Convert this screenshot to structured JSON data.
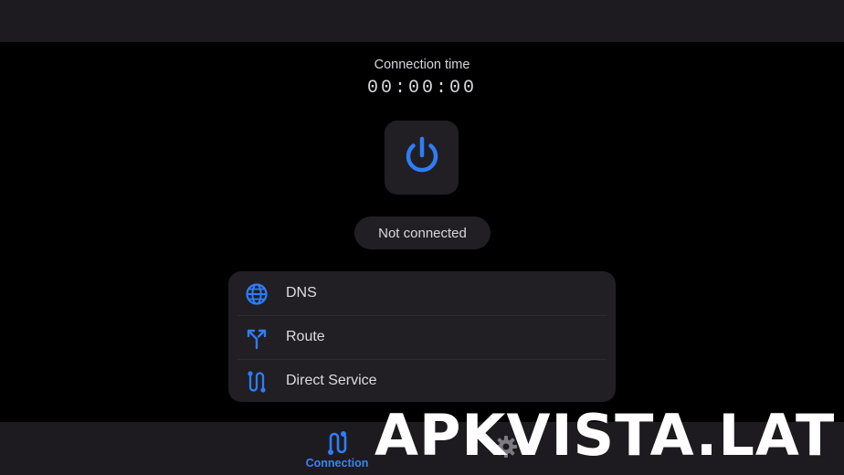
{
  "colors": {
    "accent": "#2f7df6",
    "background": "#000000",
    "surface": "#211f24",
    "bars": "#1d1b20"
  },
  "connection": {
    "time_label": "Connection time",
    "time_value": "00:00:00",
    "status": "Not connected",
    "power_icon": "power-icon"
  },
  "menu": {
    "items": [
      {
        "label": "DNS",
        "icon": "globe-icon"
      },
      {
        "label": "Route",
        "icon": "route-split-icon"
      },
      {
        "label": "Direct Service",
        "icon": "direct-path-icon"
      }
    ]
  },
  "bottom_nav": {
    "items": [
      {
        "label": "Connection",
        "icon": "connection-icon",
        "active": true
      },
      {
        "label": "",
        "icon": "gear-icon",
        "active": false
      }
    ]
  },
  "watermark": "APKVISTA.LAT"
}
